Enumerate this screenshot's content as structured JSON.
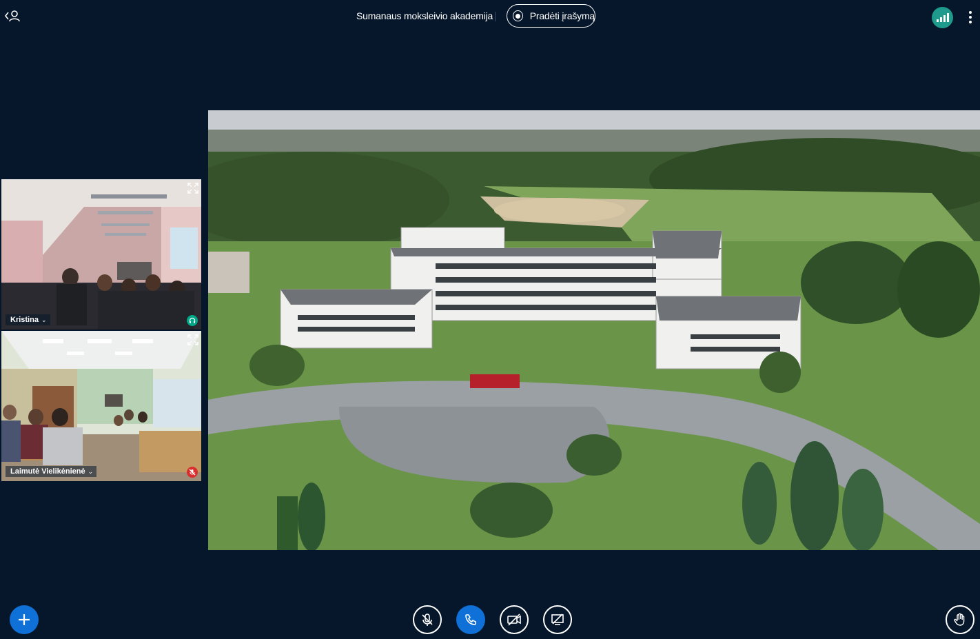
{
  "header": {
    "meeting_title": "Sumanaus moksleivio akademija",
    "record_label": "Pradėti įrašymą",
    "users_icon": "users-toggle-icon",
    "connection_icon": "signal-bars-icon",
    "options_icon": "more-vertical-icon"
  },
  "participants": [
    {
      "name": "Kristina",
      "status_icon": "headphones-icon",
      "status_color": "#00a88a"
    },
    {
      "name": "Laimutė Vielikėnienė",
      "status_icon": "muted-mic-icon",
      "status_color": "#d92e2e"
    }
  ],
  "controls": {
    "actions_icon": "plus-icon",
    "mute_icon": "microphone-muted-icon",
    "audio_icon": "phone-icon",
    "video_icon": "camera-off-icon",
    "screenshare_icon": "screenshare-off-icon",
    "raise_hand_icon": "hand-icon"
  },
  "colors": {
    "background": "#06172b",
    "primary": "#0f70d7",
    "connection": "#1e9b8c"
  }
}
